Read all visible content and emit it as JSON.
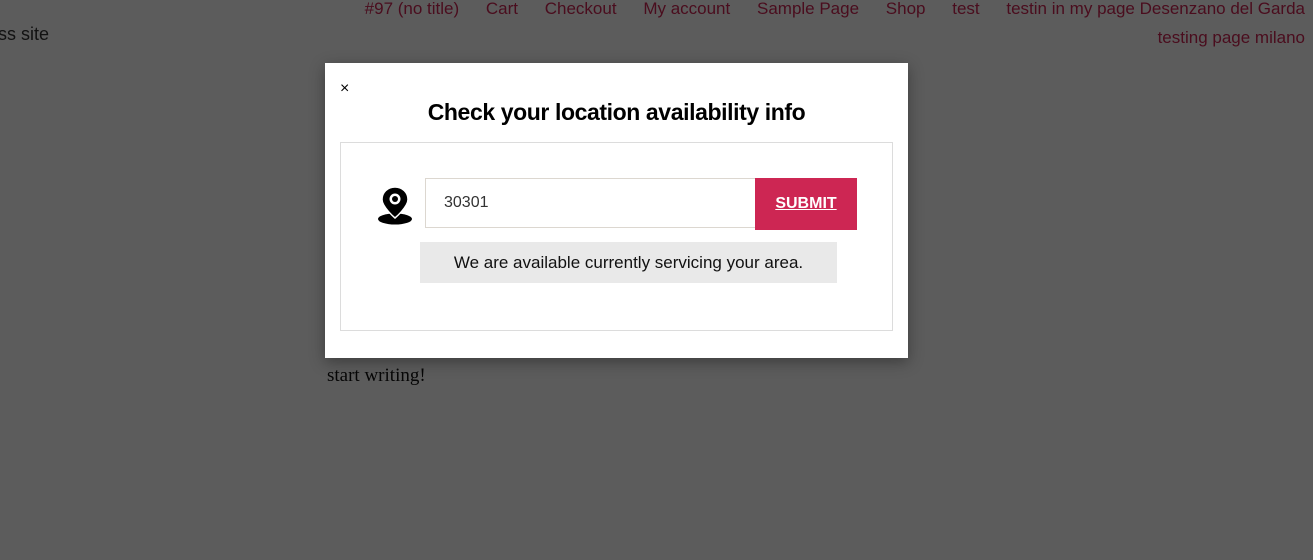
{
  "nav": {
    "items": [
      "#97 (no title)",
      "Cart",
      "Checkout",
      "My account",
      "Sample Page",
      "Shop",
      "test",
      "testin in my page Desenzano del Garda",
      "testing page milano"
    ]
  },
  "site": {
    "description_fragment": "ess site"
  },
  "content": {
    "body_text": "start writing!"
  },
  "modal": {
    "close_label": "×",
    "title": "Check your location availability info",
    "zip_value": "30301",
    "submit_label": "SUBMIT",
    "status_message": "We are available currently servicing your area.",
    "icon": "map-pin-icon"
  },
  "colors": {
    "accent": "#cd2653",
    "overlay": "rgba(0,0,0,0.64)"
  }
}
